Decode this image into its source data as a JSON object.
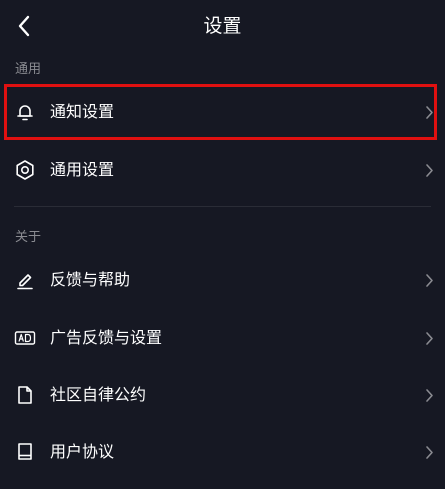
{
  "header": {
    "title": "设置",
    "back_icon": "chevron-left-icon"
  },
  "sections": [
    {
      "label": "通用",
      "items": [
        {
          "label": "通知设置",
          "icon": "bell-icon",
          "highlighted": true
        },
        {
          "label": "通用设置",
          "icon": "gear-icon"
        }
      ]
    },
    {
      "label": "关于",
      "items": [
        {
          "label": "反馈与帮助",
          "icon": "pencil-icon"
        },
        {
          "label": "广告反馈与设置",
          "icon": "ad-icon"
        },
        {
          "label": "社区自律公约",
          "icon": "document-icon"
        },
        {
          "label": "用户协议",
          "icon": "book-icon"
        }
      ]
    }
  ],
  "colors": {
    "background": "#161823",
    "highlight_border": "#e01010",
    "section_label": "#8a8b91",
    "text": "#ffffff"
  }
}
